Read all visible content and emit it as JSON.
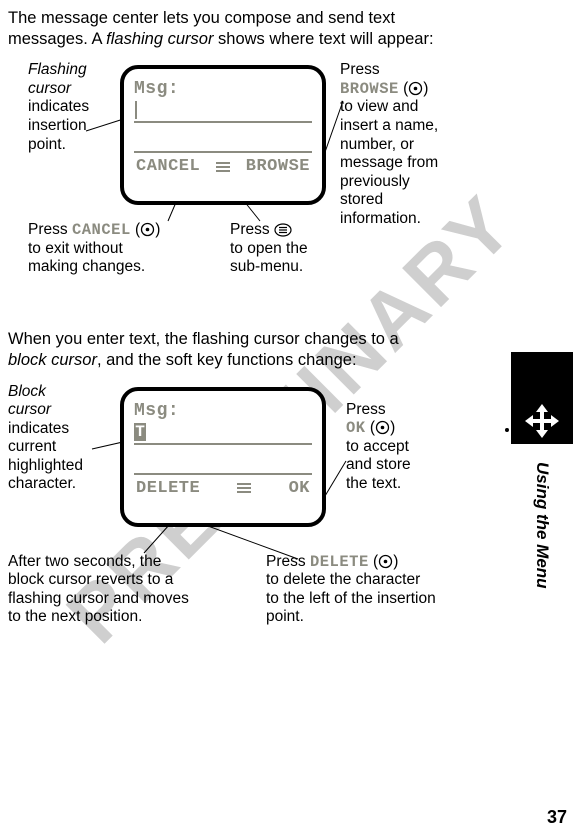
{
  "watermark": "PRELIMINARY",
  "intro": {
    "line1a": "The message center lets you compose and send text",
    "line1b": "messages. A ",
    "flashing_cursor": "flashing cursor",
    "line1c": " shows where text will appear:"
  },
  "screen1": {
    "msg_label": "Msg:",
    "left_softkey": "CANCEL",
    "right_softkey": "BROWSE"
  },
  "callouts1": {
    "flashing": {
      "l1": "Flashing",
      "l2": "cursor",
      "l3": "indicates",
      "l4": "insertion",
      "l5": "point."
    },
    "browse": {
      "l1": "Press",
      "l2": "BROWSE",
      "l3": "to view and",
      "l4": "insert a name,",
      "l5": "number, or",
      "l6": "message from",
      "l7": "previously",
      "l8": "stored",
      "l9": "information."
    },
    "cancel": {
      "l1": "Press ",
      "l2": "CANCEL",
      "l3": "to exit without",
      "l4": "making changes."
    },
    "menu": {
      "l1": "Press ",
      "l2": "to open the",
      "l3": "sub-menu."
    }
  },
  "mid": {
    "l1": "When you enter text, the flashing cursor changes to a",
    "block_cursor": "block cursor",
    "l2": ", and the soft key functions change:"
  },
  "screen2": {
    "msg_label": "Msg:",
    "block_char": "T",
    "left_softkey": "DELETE",
    "right_softkey": "OK"
  },
  "callouts2": {
    "block": {
      "l1": "Block",
      "l2": "cursor",
      "l3": "indicates",
      "l4": "current",
      "l5": "highlighted",
      "l6": "character."
    },
    "ok": {
      "l1": "Press",
      "l2": "OK",
      "l3": "to accept",
      "l4": "and store",
      "l5": "the text."
    },
    "revert": {
      "l1": "After two seconds, the",
      "l2": "block cursor reverts to a",
      "l3": "flashing cursor and moves",
      "l4": "to the next position."
    },
    "delete": {
      "l1": "Press ",
      "l2": "DELETE",
      "l3": "to delete the character",
      "l4": "to the left of the insertion",
      "l5": "point."
    }
  },
  "side": {
    "section": "Using the Menu"
  },
  "page_number": "37",
  "paren_open": " (",
  "paren_close": ")"
}
